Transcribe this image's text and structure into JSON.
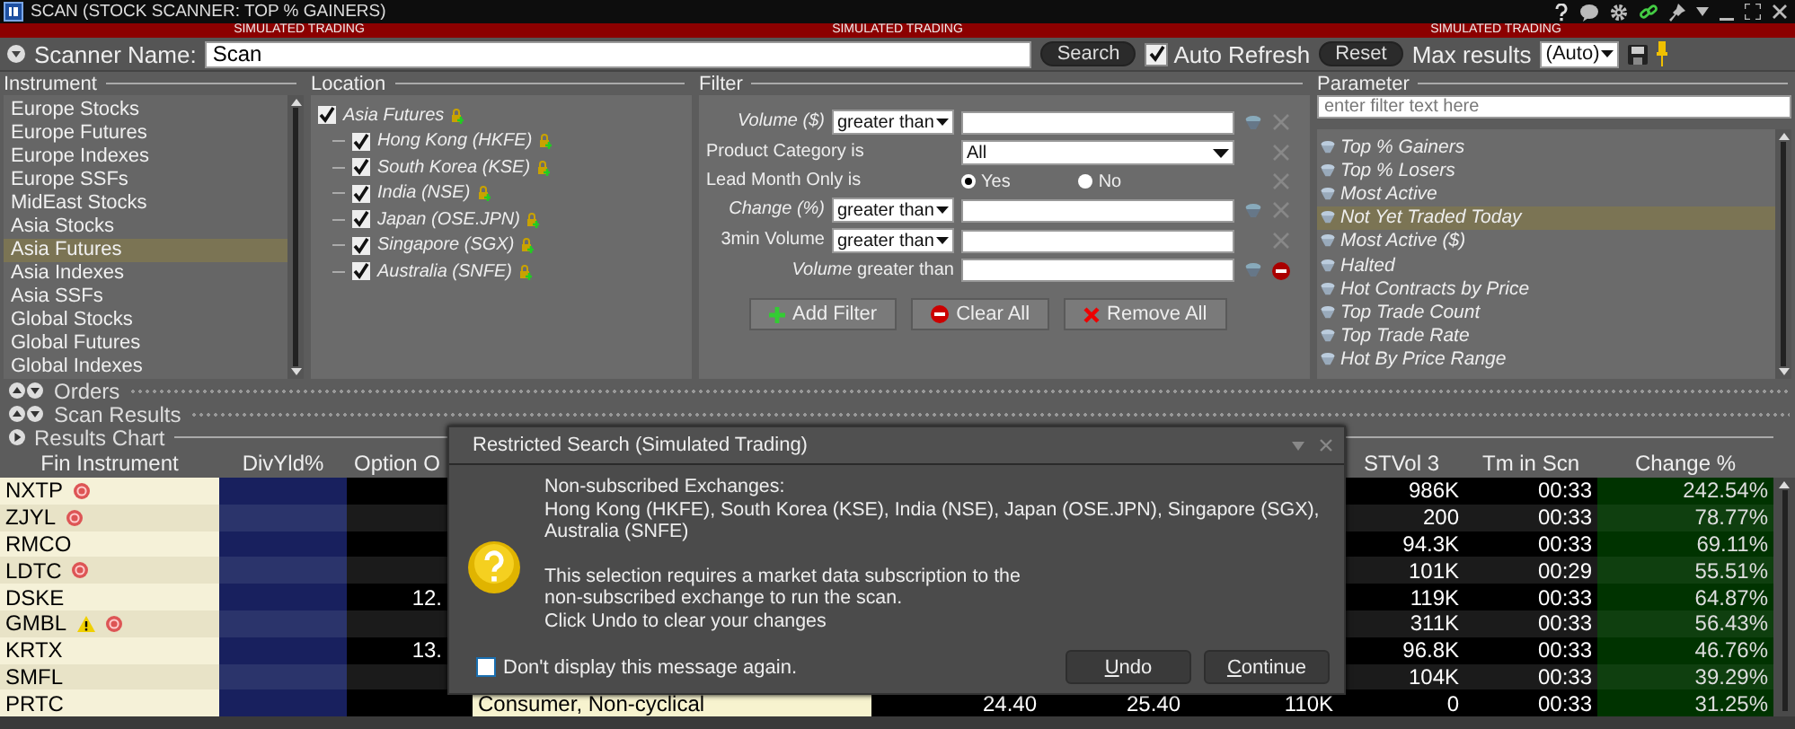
{
  "window": {
    "title": "SCAN (STOCK SCANNER: TOP % GAINERS)"
  },
  "sim_banner": [
    "SIMULATED TRADING",
    "SIMULATED TRADING",
    "SIMULATED TRADING"
  ],
  "toolbar": {
    "name_label": "Scanner Name:",
    "name_value": "Scan",
    "search_button": "Search",
    "auto_refresh": {
      "label": "Auto Refresh",
      "checked": true
    },
    "reset_button": "Reset",
    "max_results_label": "Max results",
    "max_results_value": "(Auto)"
  },
  "instrument": {
    "title": "Instrument",
    "items": [
      {
        "label": "Europe Stocks",
        "selected": false
      },
      {
        "label": "Europe Futures",
        "selected": false
      },
      {
        "label": "Europe Indexes",
        "selected": false
      },
      {
        "label": "Europe SSFs",
        "selected": false
      },
      {
        "label": "MidEast Stocks",
        "selected": false
      },
      {
        "label": "Asia Stocks",
        "selected": false
      },
      {
        "label": "Asia Futures",
        "selected": true
      },
      {
        "label": "Asia Indexes",
        "selected": false
      },
      {
        "label": "Asia SSFs",
        "selected": false
      },
      {
        "label": "Global Stocks",
        "selected": false
      },
      {
        "label": "Global Futures",
        "selected": false
      },
      {
        "label": "Global Indexes",
        "selected": false
      }
    ]
  },
  "location": {
    "title": "Location",
    "tree": [
      {
        "label": "Asia Futures",
        "checked": true,
        "locked": true,
        "children": [
          {
            "label": "Hong Kong (HKFE)",
            "checked": true,
            "locked": true
          },
          {
            "label": "South Korea (KSE)",
            "checked": true,
            "locked": true
          },
          {
            "label": "India (NSE)",
            "checked": true,
            "locked": true
          },
          {
            "label": "Japan (OSE.JPN)",
            "checked": true,
            "locked": true
          },
          {
            "label": "Singapore (SGX)",
            "checked": true,
            "locked": true
          },
          {
            "label": "Australia (SNFE)",
            "checked": true,
            "locked": true
          }
        ]
      }
    ]
  },
  "filter": {
    "title": "Filter",
    "rows": [
      {
        "kind": "compare",
        "label": "Volume ($)",
        "italic": true,
        "operator": "greater than",
        "filter_icon": true,
        "remove_disabled": true
      },
      {
        "kind": "select",
        "label": "Product Category is",
        "italic": false,
        "value": "All",
        "filter_icon": false,
        "remove_disabled": true
      },
      {
        "kind": "radio",
        "label": "Lead Month Only is",
        "italic": false,
        "options": [
          {
            "label": "Yes",
            "selected": true
          },
          {
            "label": "No",
            "selected": false
          }
        ],
        "filter_icon": false,
        "remove_disabled": true
      },
      {
        "kind": "compare",
        "label": "Change (%)",
        "italic": true,
        "operator": "greater than",
        "filter_icon": true,
        "remove_disabled": true
      },
      {
        "kind": "compare",
        "label": "3min Volume",
        "italic": false,
        "operator": "greater than",
        "filter_icon": false,
        "remove_disabled": true
      },
      {
        "kind": "preset",
        "label": "*Volume* greater than",
        "italic": false,
        "filter_icon": true,
        "remove_disabled": false
      }
    ],
    "buttons": [
      {
        "label": "Add Filter",
        "kind": "add"
      },
      {
        "label": "Clear All",
        "kind": "clear"
      },
      {
        "label": "Remove All",
        "kind": "remove"
      }
    ]
  },
  "parameter": {
    "title": "Parameter",
    "search": {
      "placeholder": "enter filter text here"
    },
    "items": [
      {
        "label": "Top % Gainers",
        "selected": false
      },
      {
        "label": "Top % Losers",
        "selected": false
      },
      {
        "label": "Most Active",
        "selected": false
      },
      {
        "label": "Not Yet Traded Today",
        "selected": true
      },
      {
        "label": "Most Active ($)",
        "selected": false
      },
      {
        "label": "Halted",
        "selected": false
      },
      {
        "label": "Hot Contracts by Price",
        "selected": false
      },
      {
        "label": "Top Trade Count",
        "selected": false
      },
      {
        "label": "Top Trade Rate",
        "selected": false
      },
      {
        "label": "Hot By Price Range",
        "selected": false
      }
    ]
  },
  "panes": [
    {
      "label": "Orders",
      "kind": "collapsed"
    },
    {
      "label": "Scan Results",
      "kind": "collapsed"
    },
    {
      "label": "Results Chart",
      "kind": "expanded"
    }
  ],
  "table": {
    "columns": [
      "Fin Instrument",
      "DivYld%",
      "Option O",
      "STVol 3",
      "Tm in Scn",
      "Change %"
    ],
    "rows": [
      {
        "symbol": "NXTP",
        "warning": false,
        "restricted": true,
        "stvol": "986K",
        "tm": "00:33",
        "change": "242.54%"
      },
      {
        "symbol": "ZJYL",
        "warning": false,
        "restricted": true,
        "stvol": "200",
        "tm": "00:33",
        "change": "78.77%"
      },
      {
        "symbol": "RMCO",
        "warning": false,
        "restricted": false,
        "stvol": "94.3K",
        "tm": "00:33",
        "change": "69.11%"
      },
      {
        "symbol": "LDTC",
        "warning": false,
        "restricted": true,
        "stvol": "101K",
        "tm": "00:29",
        "change": "55.51%"
      },
      {
        "symbol": "DSKE",
        "warning": false,
        "restricted": false,
        "option": "12.",
        "stvol": "119K",
        "tm": "00:33",
        "change": "64.87%"
      },
      {
        "symbol": "GMBL",
        "warning": true,
        "restricted": true,
        "stvol": "311K",
        "tm": "00:33",
        "change": "56.43%"
      },
      {
        "symbol": "KRTX",
        "warning": false,
        "restricted": false,
        "option": "13.",
        "stvol": "96.8K",
        "tm": "00:33",
        "change": "46.76%"
      },
      {
        "symbol": "SMFL",
        "warning": false,
        "restricted": false,
        "stvol": "104K",
        "tm": "00:33",
        "change": "39.29%"
      },
      {
        "symbol": "PRTC",
        "warning": false,
        "restricted": false,
        "column_4": "Consumer, Non-cyclical",
        "column_5": "24.40",
        "column_6": "25.40",
        "column_7": "110K",
        "stvol": "0",
        "tm": "00:33",
        "change": "31.25%"
      }
    ]
  },
  "dialog": {
    "title": "Restricted Search  (Simulated Trading)",
    "exchanges_heading": "Non-subscribed Exchanges:",
    "exchanges": "Hong Kong (HKFE), South Korea (KSE), India (NSE), Japan (OSE.JPN), Singapore (SGX), Australia (SNFE)",
    "message_lines": [
      "This selection requires a market data subscription to the",
      "non-subscribed exchange to run the scan.",
      "Click Undo to clear your changes"
    ],
    "dont_show": {
      "label": "Don't display this message again.",
      "checked": false
    },
    "buttons": [
      "Undo",
      "Continue"
    ]
  }
}
